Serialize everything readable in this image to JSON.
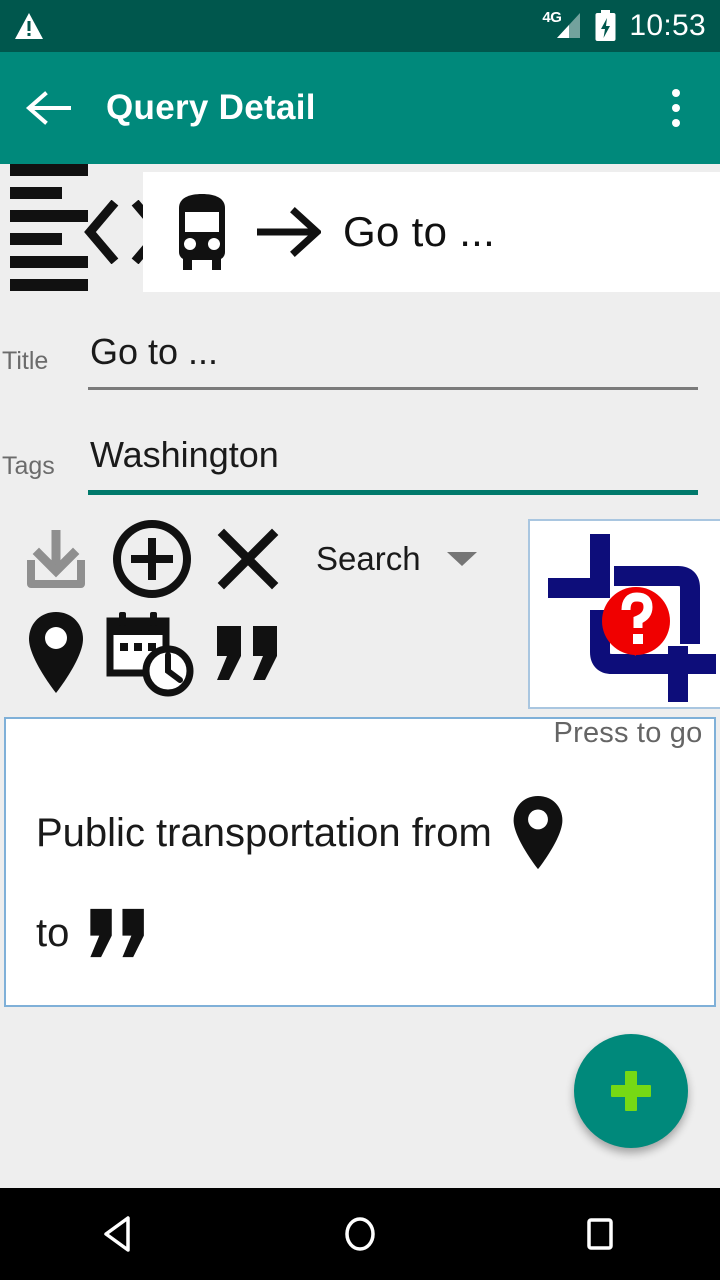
{
  "status_bar": {
    "warning_icon": "warning-triangle-icon",
    "network_type": "4G",
    "signal_icon": "signal-bars-icon",
    "battery_icon": "battery-charging-icon",
    "time": "10:53",
    "background_color": "#00574d"
  },
  "app_bar": {
    "back_icon": "back-arrow-icon",
    "title": "Query Detail",
    "overflow_icon": "overflow-menu-icon",
    "background_color": "#00897b"
  },
  "header_strip": {
    "lines_icon": "text-lines-icon",
    "prev_icon": "chevron-left-icon",
    "next_icon": "chevron-right-icon",
    "card": {
      "transport_icon": "bus-icon",
      "arrow_icon": "arrow-right-icon",
      "label": "Go to ..."
    }
  },
  "form": {
    "title_field": {
      "label": "Title",
      "value": "Go to ...",
      "focused": false
    },
    "tags_field": {
      "label": "Tags",
      "value": "Washington",
      "focused": true,
      "accent_color": "#00796b"
    }
  },
  "toolbar": {
    "row1": [
      {
        "name": "import-icon",
        "label": "Import",
        "enabled": false
      },
      {
        "name": "add-circle-icon",
        "label": "Add",
        "enabled": true
      },
      {
        "name": "close-icon",
        "label": "Remove",
        "enabled": true
      }
    ],
    "row2": [
      {
        "name": "location-pin-icon",
        "label": "Location",
        "enabled": true
      },
      {
        "name": "calendar-clock-icon",
        "label": "Date and time",
        "enabled": true
      },
      {
        "name": "quote-icon",
        "label": "Free text",
        "enabled": true
      }
    ],
    "spinner": {
      "value": "Search",
      "caret_icon": "chevron-down-icon"
    }
  },
  "logo_panel": {
    "logo_icon": "app-logo-question-icon",
    "logo_colors": {
      "bracket": "#0d0d7a",
      "circle": "#f00000",
      "mark": "#ffffff"
    },
    "caption": "Press to go"
  },
  "query_card": {
    "border_color": "#7fb0d8",
    "line1_text": "Public transportation from",
    "line1_icon": "location-pin-icon",
    "line2_text": "to",
    "line2_icon": "quote-icon"
  },
  "fab": {
    "icon": "plus-icon",
    "background_color": "#00897b",
    "icon_color": "#76d914"
  },
  "nav_bar": {
    "back_icon": "nav-back-triangle-icon",
    "home_icon": "nav-home-circle-icon",
    "recents_icon": "nav-recents-square-icon",
    "background_color": "#000000"
  }
}
